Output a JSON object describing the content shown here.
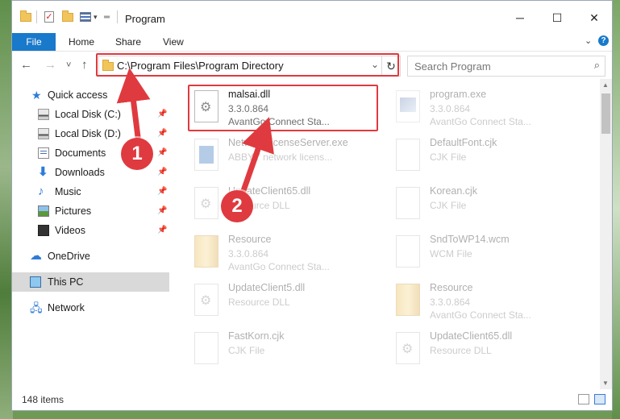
{
  "window": {
    "title": "Program",
    "minimize": "─",
    "maximize": "☐",
    "close": "✕"
  },
  "ribbon": {
    "tabs": [
      "File",
      "Home",
      "Share",
      "View"
    ],
    "collapse_icon": "chevron-down-icon",
    "help": "?"
  },
  "nav": {
    "back": "←",
    "forward": "→",
    "recent": "˅",
    "up": "↑",
    "address": "C:\\Program Files\\Program Directory",
    "search_placeholder": "Search Program"
  },
  "sidebar": {
    "items": [
      {
        "label": "Quick access",
        "icon": "star-icon"
      },
      {
        "label": "Local Disk (C:)",
        "icon": "disk-icon",
        "pinned": true
      },
      {
        "label": "Local Disk (D:)",
        "icon": "disk-icon",
        "pinned": true
      },
      {
        "label": "Documents",
        "icon": "documents-icon",
        "pinned": true
      },
      {
        "label": "Downloads",
        "icon": "downloads-icon",
        "pinned": true
      },
      {
        "label": "Music",
        "icon": "music-icon",
        "pinned": true
      },
      {
        "label": "Pictures",
        "icon": "pictures-icon",
        "pinned": true
      },
      {
        "label": "Videos",
        "icon": "videos-icon",
        "pinned": true
      },
      {
        "label": "OneDrive",
        "icon": "onedrive-icon"
      },
      {
        "label": "This PC",
        "icon": "pc-icon",
        "selected": true
      },
      {
        "label": "Network",
        "icon": "network-icon"
      }
    ]
  },
  "files": [
    {
      "name": "malsai.dll",
      "line1": "3.3.0.864",
      "line2": "AvantGo Connect Sta...",
      "icon": "dll-file-icon",
      "highlighted": true
    },
    {
      "name": "program.exe",
      "line1": "3.3.0.864",
      "line2": "AvantGo Connect Sta...",
      "icon": "program-exe-icon"
    },
    {
      "name": "NetworkLicenseServer.exe",
      "line1": "ABBYY network licens...",
      "line2": "",
      "icon": "exe-icon"
    },
    {
      "name": "DefaultFont.cjk",
      "line1": "CJK File",
      "line2": "",
      "icon": "file-icon"
    },
    {
      "name": "UpdateClient65.dll",
      "line1": "Resource DLL",
      "line2": "",
      "icon": "dll-file-icon"
    },
    {
      "name": "Korean.cjk",
      "line1": "CJK File",
      "line2": "",
      "icon": "file-icon"
    },
    {
      "name": "Resource",
      "line1": "3.3.0.864",
      "line2": "AvantGo Connect Sta...",
      "icon": "folder-file-icon"
    },
    {
      "name": "SndToWP14.wcm",
      "line1": "WCM File",
      "line2": "",
      "icon": "file-icon"
    },
    {
      "name": "UpdateClient5.dll",
      "line1": "Resource DLL",
      "line2": "",
      "icon": "dll-file-icon"
    },
    {
      "name": "Resource",
      "line1": "3.3.0.864",
      "line2": "AvantGo Connect Sta...",
      "icon": "folder-file-icon"
    },
    {
      "name": "FastKorn.cjk",
      "line1": "CJK File",
      "line2": "",
      "icon": "file-icon"
    },
    {
      "name": "UpdateClient65.dll",
      "line1": "Resource DLL",
      "line2": "",
      "icon": "dll-file-icon"
    }
  ],
  "status": {
    "item_count": "148 items"
  },
  "annotations": {
    "step1": "1",
    "step2": "2",
    "highlight_color": "#e0393e",
    "accent_color": "#1979ca"
  }
}
